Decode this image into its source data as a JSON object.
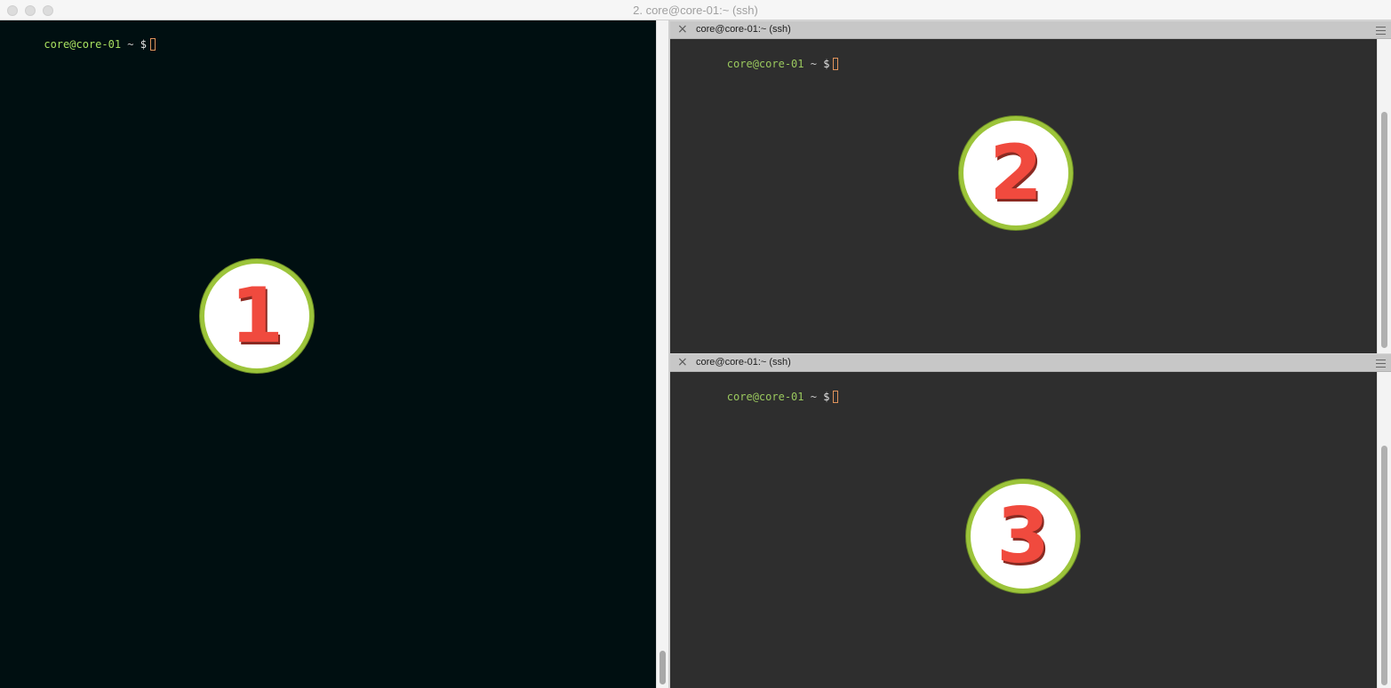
{
  "window": {
    "title": "2. core@core-01:~ (ssh)"
  },
  "panes": {
    "left": {
      "prompt_user_host": "core@core-01",
      "prompt_path": "~",
      "prompt_symbol": "$",
      "badge_number": "1"
    },
    "top_right": {
      "header_title": "core@core-01:~ (ssh)",
      "close_symbol": "×",
      "prompt_user_host": "core@core-01",
      "prompt_path": "~",
      "prompt_symbol": "$",
      "badge_number": "2"
    },
    "bottom_right": {
      "header_title": "core@core-01:~ (ssh)",
      "close_symbol": "×",
      "prompt_user_host": "core@core-01",
      "prompt_path": "~",
      "prompt_symbol": "$",
      "badge_number": "3"
    }
  },
  "colors": {
    "left_background": "#000f11",
    "right_background": "#2e2e2e",
    "prompt_user_host": "#a9e060",
    "cursor": "#e0935b",
    "badge_ring": "#9cc43a",
    "badge_digit": "#f04a3e"
  },
  "icons": {
    "close_window": "close-dot",
    "minimize_window": "minimize-dot",
    "maximize_window": "maximize-dot",
    "pane_close": "close-icon",
    "pane_menu": "hamburger-menu-icon"
  }
}
